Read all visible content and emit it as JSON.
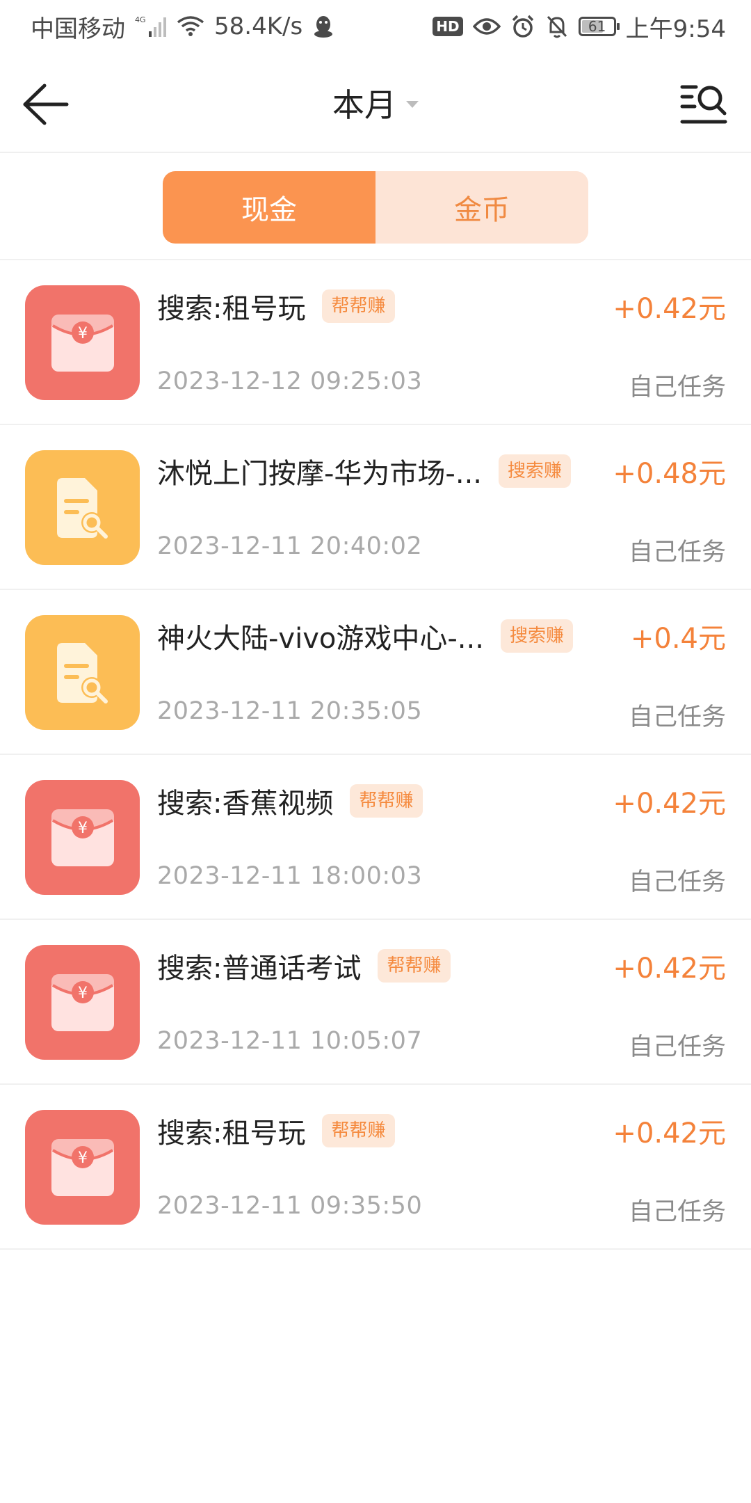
{
  "status_bar": {
    "carrier": "中国移动",
    "network_type": "4G",
    "speed": "58.4K/s",
    "hd_badge": "HD",
    "battery": "61",
    "time": "上午9:54"
  },
  "header": {
    "title": "本月"
  },
  "tabs": [
    {
      "label": "现金",
      "active": true
    },
    {
      "label": "金币",
      "active": false
    }
  ],
  "records": [
    {
      "icon": "red-envelope-icon",
      "title": "搜索:租号玩",
      "tag": "帮帮赚",
      "amount": "+0.42元",
      "time": "2023-12-12 09:25:03",
      "source": "自己任务"
    },
    {
      "icon": "search-document-icon",
      "title": "沐悦上门按摩-华为市场-...",
      "tag": "搜索赚",
      "amount": "+0.48元",
      "time": "2023-12-11 20:40:02",
      "source": "自己任务"
    },
    {
      "icon": "search-document-icon",
      "title": "神火大陆-vivo游戏中心-...",
      "tag": "搜索赚",
      "amount": "+0.4元",
      "time": "2023-12-11 20:35:05",
      "source": "自己任务"
    },
    {
      "icon": "red-envelope-icon",
      "title": "搜索:香蕉视频",
      "tag": "帮帮赚",
      "amount": "+0.42元",
      "time": "2023-12-11 18:00:03",
      "source": "自己任务"
    },
    {
      "icon": "red-envelope-icon",
      "title": "搜索:普通话考试",
      "tag": "帮帮赚",
      "amount": "+0.42元",
      "time": "2023-12-11 10:05:07",
      "source": "自己任务"
    },
    {
      "icon": "red-envelope-icon",
      "title": "搜索:租号玩",
      "tag": "帮帮赚",
      "amount": "+0.42元",
      "time": "2023-12-11 09:35:50",
      "source": "自己任务"
    }
  ],
  "colors": {
    "accent": "#fb9450",
    "amount": "#f4823a",
    "red_icon_bg": "#f1736a",
    "yellow_icon_bg": "#fcbd55"
  }
}
